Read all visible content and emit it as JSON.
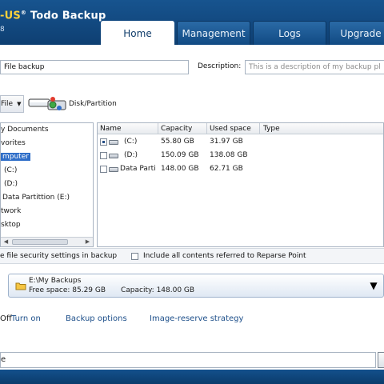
{
  "header": {
    "brand_partial": "EaseUS",
    "brand_partial_visible": "-US",
    "brand_name": "Todo Backup",
    "version_fragment": "8",
    "tabs": [
      {
        "label": "Home",
        "active": true
      },
      {
        "label": "Management",
        "active": false
      },
      {
        "label": "Logs",
        "active": false
      },
      {
        "label": "Upgrade",
        "active": false
      }
    ]
  },
  "form": {
    "name_value": "File backup",
    "description_label": "Description:",
    "description_placeholder": "This is a description of my backup pl"
  },
  "toolbar": {
    "file_label": "File",
    "disk_partition_label": "Disk/Partition"
  },
  "tree": {
    "items": [
      {
        "label": "Documents",
        "prefix": "y",
        "selected": false
      },
      {
        "label": "vorites",
        "prefix": "",
        "selected": false
      },
      {
        "label": "mputer",
        "prefix": "",
        "selected": true
      },
      {
        "label": "(C:)",
        "prefix": "",
        "selected": false
      },
      {
        "label": "(D:)",
        "prefix": "",
        "selected": false
      },
      {
        "label": "Data Partittion (E:)",
        "prefix": "",
        "selected": false
      },
      {
        "label": "twork",
        "prefix": "",
        "selected": false
      },
      {
        "label": "sktop",
        "prefix": "",
        "selected": false
      }
    ]
  },
  "disks": {
    "columns": [
      "Name",
      "Capacity",
      "Used space",
      "Type"
    ],
    "rows": [
      {
        "name": "(C:)",
        "capacity": "55.80 GB",
        "used": "31.97 GB",
        "type": "",
        "state": "partial"
      },
      {
        "name": "(D:)",
        "capacity": "150.09 GB",
        "used": "138.08 GB",
        "type": "",
        "state": "unchecked"
      },
      {
        "name": "Data Parti",
        "capacity": "148.00 GB",
        "used": "62.71 GB",
        "type": "",
        "state": "unchecked"
      }
    ]
  },
  "options": {
    "security_label": "e file security settings in backup",
    "reparse_label": "Include all contents referred to Reparse Point"
  },
  "destination": {
    "path": "E:\\My Backups",
    "free_space": "Free space: 85.29 GB",
    "capacity": "Capacity: 148.00 GB"
  },
  "links": {
    "off_fragment": "Off",
    "turn_on": "Turn on",
    "backup_options": "Backup options",
    "image_reserve": "Image-reserve strategy"
  },
  "bottom": {
    "fragment": "e"
  },
  "colors": {
    "header": "#17548f",
    "accent_link": "#1d4f8a",
    "selection": "#2f6ec8"
  }
}
